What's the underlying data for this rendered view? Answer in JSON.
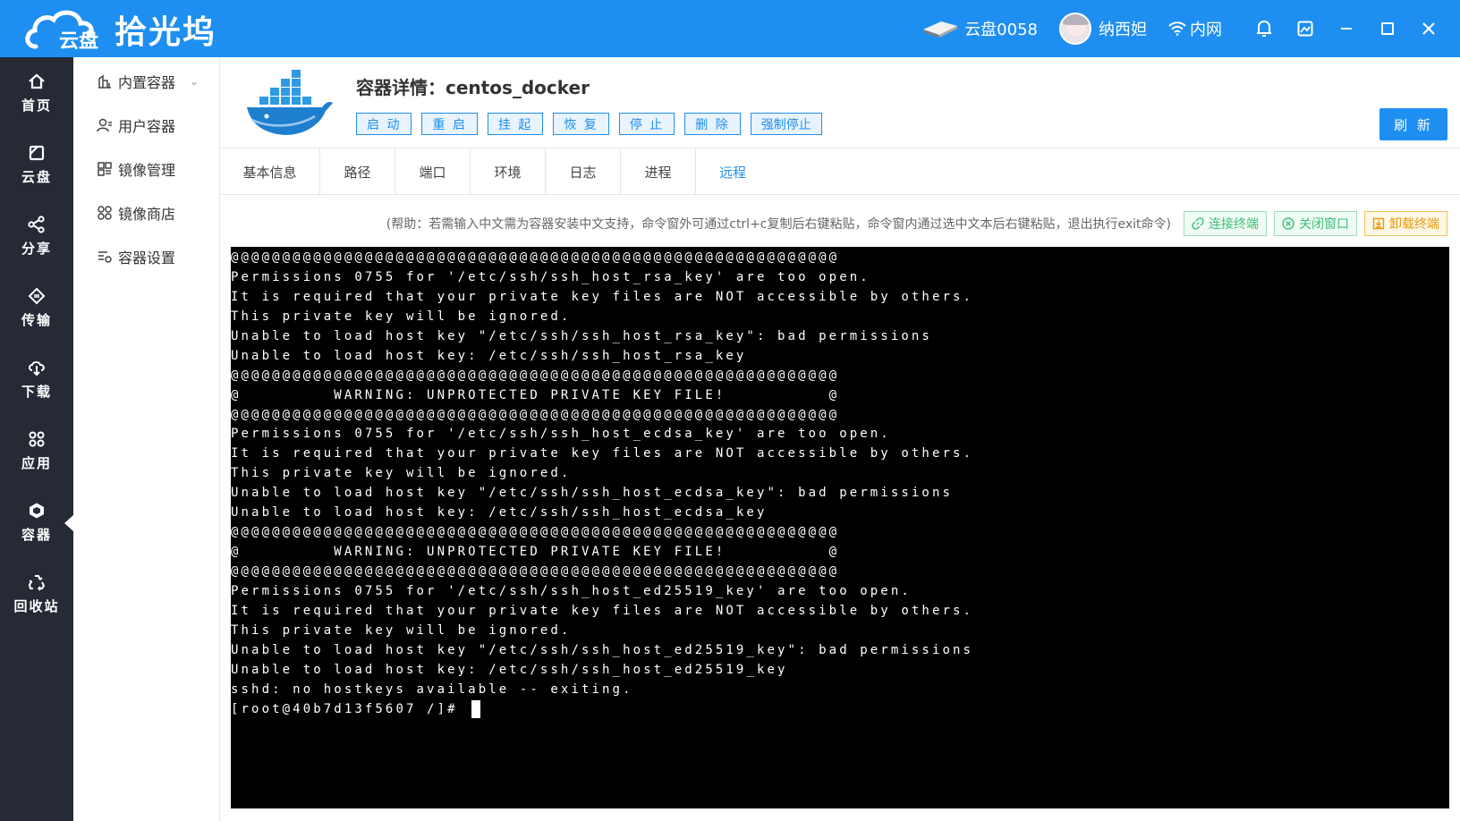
{
  "app": {
    "brand_icon_text": "云盘",
    "brand_name": "拾光坞"
  },
  "topbar": {
    "disk_label": "云盘0058",
    "user_name": "纳西妲",
    "network_label": "内网",
    "icons": [
      "disk-icon",
      "bell-icon",
      "screenshot-icon",
      "minimize-icon",
      "maximize-icon",
      "close-icon"
    ]
  },
  "sidebar": {
    "items": [
      {
        "label": "首页",
        "icon": "home-icon"
      },
      {
        "label": "云盘",
        "icon": "cloud-disk-icon"
      },
      {
        "label": "分享",
        "icon": "share-icon"
      },
      {
        "label": "传输",
        "icon": "transfer-icon"
      },
      {
        "label": "下载",
        "icon": "download-icon"
      },
      {
        "label": "应用",
        "icon": "apps-icon"
      },
      {
        "label": "容器",
        "icon": "container-icon",
        "active": true
      },
      {
        "label": "回收站",
        "icon": "recycle-icon"
      }
    ]
  },
  "submenu": {
    "items": [
      {
        "label": "内置容器",
        "icon": "builtin-container-icon"
      },
      {
        "label": "用户容器",
        "icon": "user-container-icon"
      },
      {
        "label": "镜像管理",
        "icon": "image-manage-icon"
      },
      {
        "label": "镜像商店",
        "icon": "image-store-icon"
      },
      {
        "label": "容器设置",
        "icon": "container-settings-icon"
      }
    ]
  },
  "header": {
    "title": "容器详情：centos_docker",
    "actions": [
      "启 动",
      "重 启",
      "挂 起",
      "恢 复",
      "停 止",
      "删 除",
      "强制停止"
    ],
    "refresh_label": "刷 新"
  },
  "tabs": [
    "基本信息",
    "路径",
    "端口",
    "环境",
    "日志",
    "进程",
    "远程"
  ],
  "active_tab": "远程",
  "terminal_bar": {
    "help": "(帮助：若需输入中文需为容器安装中文支持，命令窗外可通过ctrl+c复制后右键粘贴，命令窗内通过选中文本后右键粘贴，退出执行exit命令)",
    "connect_label": "连接终端",
    "close_label": "关闭窗口",
    "unload_label": "卸载终端"
  },
  "terminal": {
    "lines": [
      "@@@@@@@@@@@@@@@@@@@@@@@@@@@@@@@@@@@@@@@@@@@@@@@@@@@@@@@@@@@",
      "Permissions 0755 for '/etc/ssh/ssh_host_rsa_key' are too open.",
      "It is required that your private key files are NOT accessible by others.",
      "This private key will be ignored.",
      "Unable to load host key \"/etc/ssh/ssh_host_rsa_key\": bad permissions",
      "Unable to load host key: /etc/ssh/ssh_host_rsa_key",
      "@@@@@@@@@@@@@@@@@@@@@@@@@@@@@@@@@@@@@@@@@@@@@@@@@@@@@@@@@@@",
      "@         WARNING: UNPROTECTED PRIVATE KEY FILE!          @",
      "@@@@@@@@@@@@@@@@@@@@@@@@@@@@@@@@@@@@@@@@@@@@@@@@@@@@@@@@@@@",
      "Permissions 0755 for '/etc/ssh/ssh_host_ecdsa_key' are too open.",
      "It is required that your private key files are NOT accessible by others.",
      "This private key will be ignored.",
      "Unable to load host key \"/etc/ssh/ssh_host_ecdsa_key\": bad permissions",
      "Unable to load host key: /etc/ssh/ssh_host_ecdsa_key",
      "@@@@@@@@@@@@@@@@@@@@@@@@@@@@@@@@@@@@@@@@@@@@@@@@@@@@@@@@@@@",
      "@         WARNING: UNPROTECTED PRIVATE KEY FILE!          @",
      "@@@@@@@@@@@@@@@@@@@@@@@@@@@@@@@@@@@@@@@@@@@@@@@@@@@@@@@@@@@",
      "Permissions 0755 for '/etc/ssh/ssh_host_ed25519_key' are too open.",
      "It is required that your private key files are NOT accessible by others.",
      "This private key will be ignored.",
      "Unable to load host key \"/etc/ssh/ssh_host_ed25519_key\": bad permissions",
      "Unable to load host key: /etc/ssh/ssh_host_ed25519_key",
      "sshd: no hostkeys available -- exiting."
    ],
    "prompt": "[root@40b7d13f5607 /]# "
  },
  "colors": {
    "brand_blue": "#1e8ff0",
    "sidebar_bg": "#252a35",
    "success_green": "#3cbf74",
    "warning_orange": "#e79a0c",
    "terminal_bg": "#000000"
  }
}
